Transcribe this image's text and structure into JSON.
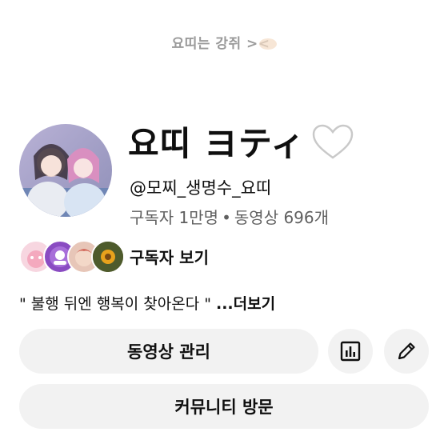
{
  "banner": {
    "text": "요띠는 강쥐 ><"
  },
  "channel": {
    "name": "요띠 ヨティ",
    "handle": "@모찌_생명수_요띠",
    "subscribers": "구독자 1만명",
    "separator": "•",
    "videos": "동영상 696개"
  },
  "subscribers_link": {
    "label": "구독자 보기"
  },
  "description": {
    "text": "\" 불행 뒤엔 행복이 찾아온다 \" ",
    "more": "...더보기"
  },
  "buttons": {
    "manage_videos": "동영상 관리",
    "community": "커뮤니티 방문"
  },
  "icons": {
    "heart": "white-heart-icon",
    "analytics": "analytics-icon",
    "edit": "pencil-icon"
  }
}
